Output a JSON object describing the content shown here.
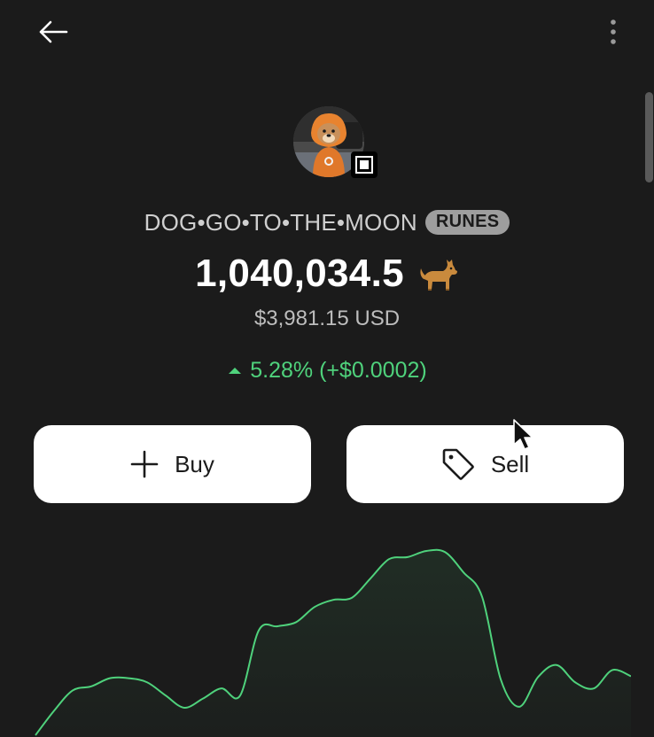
{
  "nav": {
    "back_icon": "arrow-left-icon",
    "more_icon": "more-vertical-icon"
  },
  "token": {
    "name": "DOG•GO•TO•THE•MOON",
    "tag": "RUNES",
    "balance": "1,040,034.5",
    "emoji": "🐕",
    "usd_value": "$3,981.15 USD",
    "change": "5.28% (+$0.0002)",
    "change_direction": "up"
  },
  "actions": {
    "buy_label": "Buy",
    "sell_label": "Sell"
  },
  "colors": {
    "background": "#1b1b1b",
    "positive": "#4fd27c",
    "tag_bg": "#9e9e9e",
    "button_bg": "#ffffff"
  },
  "chart_data": {
    "type": "area",
    "x": [
      0,
      1,
      2,
      3,
      4,
      5,
      6,
      7,
      8,
      9,
      10,
      11,
      12,
      13,
      14,
      15,
      16,
      17,
      18,
      19,
      20,
      21,
      22,
      23,
      24,
      25,
      26,
      27,
      28,
      29,
      30,
      31,
      32,
      33,
      34,
      35,
      36,
      37,
      38,
      39,
      40
    ],
    "values": [
      0,
      2.4,
      4.4,
      4.8,
      5.6,
      5.6,
      5.2,
      3.9,
      2.7,
      3.6,
      4.6,
      3.9,
      10.3,
      10.7,
      11.1,
      12.6,
      13.3,
      13.5,
      15.4,
      17.3,
      17.5,
      18.1,
      18.0,
      16.0,
      13.6,
      5.5,
      2.8,
      5.7,
      6.9,
      5.2,
      4.6,
      6.4,
      5.8
    ],
    "line_color": "#4fd27c",
    "grid": false,
    "axes": false
  }
}
